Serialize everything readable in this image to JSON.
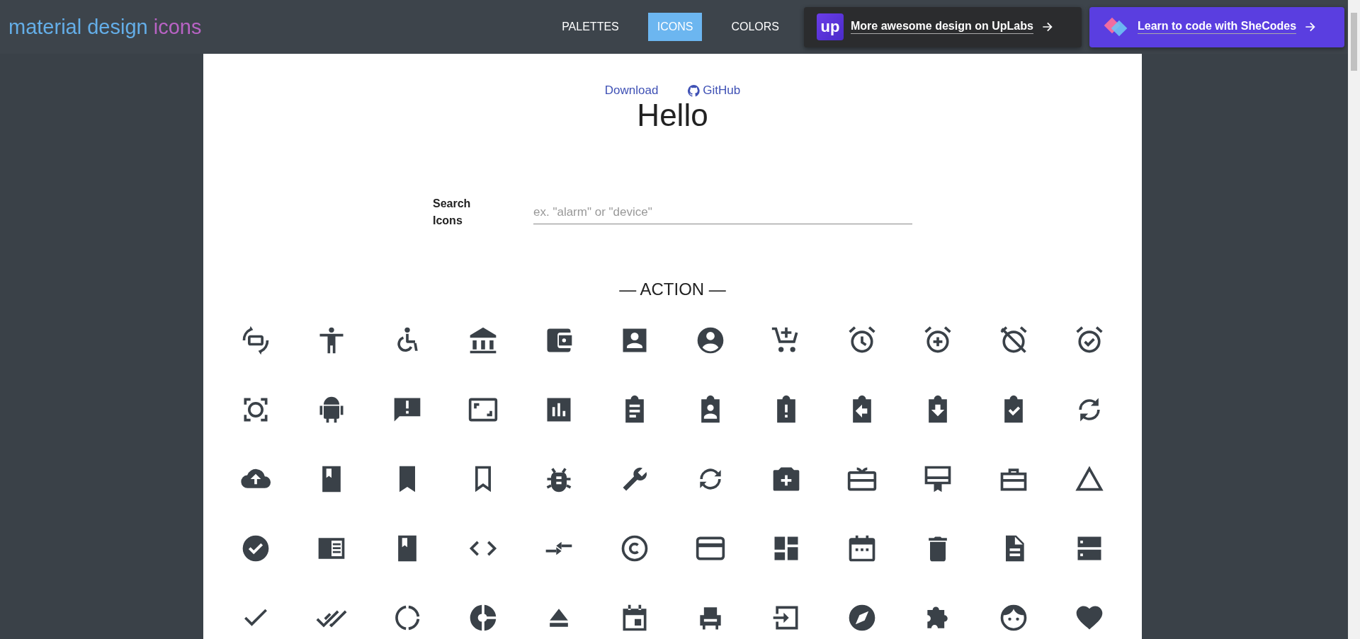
{
  "header": {
    "logo": {
      "primary": "material design",
      "accent": "icons"
    },
    "nav": [
      {
        "label": "PALETTES",
        "selected": false
      },
      {
        "label": "ICONS",
        "selected": true
      },
      {
        "label": "COLORS",
        "selected": false
      }
    ],
    "promos": [
      {
        "kind": "uplabs",
        "logo_text": "up",
        "label": "More awesome design on UpLabs"
      },
      {
        "kind": "shecodes",
        "label": "Learn to code with SheCodes"
      }
    ]
  },
  "links": [
    {
      "kind": "download",
      "label": "Download"
    },
    {
      "kind": "github",
      "label": "GitHub"
    }
  ],
  "title": "Hello",
  "search": {
    "label": "Search Icons",
    "placeholder": "ex. \"alarm\" or \"device\""
  },
  "section": {
    "heading": "— ACTION —"
  }
}
